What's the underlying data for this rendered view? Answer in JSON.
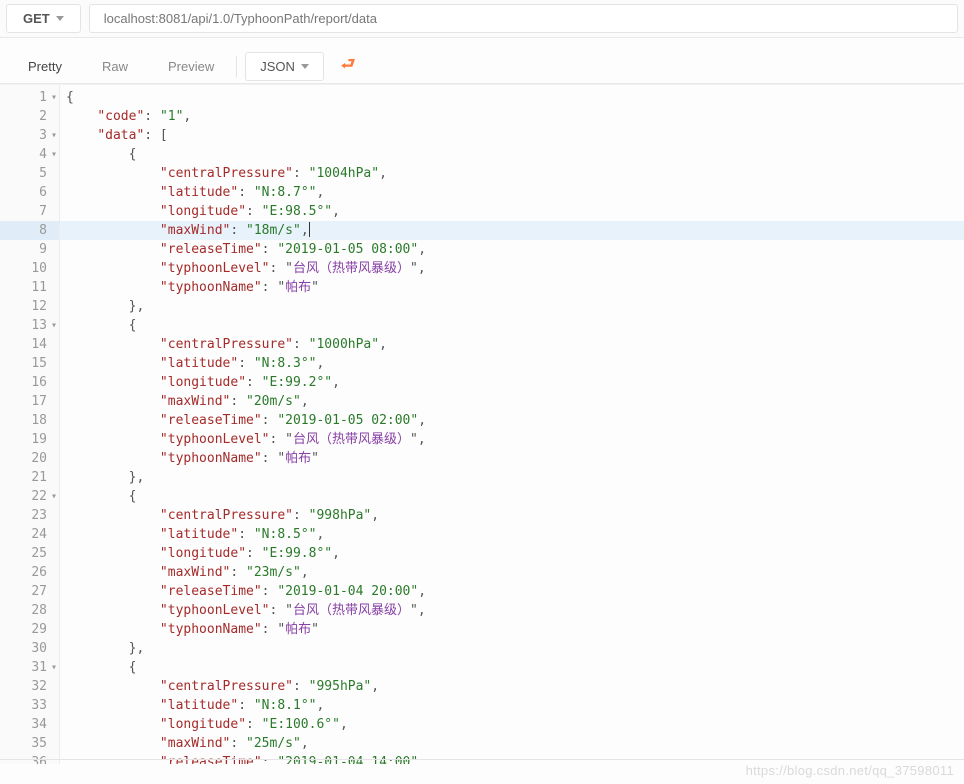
{
  "top": {
    "method": "GET",
    "url": "localhost:8081/api/1.0/TyphoonPath/report/data"
  },
  "tabs": {
    "pretty": "Pretty",
    "raw": "Raw",
    "preview": "Preview",
    "format": "JSON"
  },
  "highlighted_line": 8,
  "watermark": "https://blog.csdn.net/qq_37598011",
  "lines": [
    {
      "n": 1,
      "fold": true,
      "indent": 0,
      "type": "punc",
      "text": "{"
    },
    {
      "n": 2,
      "fold": false,
      "indent": 1,
      "type": "kv_str",
      "key": "code",
      "value": "1",
      "comma": true
    },
    {
      "n": 3,
      "fold": true,
      "indent": 1,
      "type": "key_open",
      "key": "data",
      "open": "["
    },
    {
      "n": 4,
      "fold": true,
      "indent": 2,
      "type": "punc",
      "text": "{"
    },
    {
      "n": 5,
      "fold": false,
      "indent": 3,
      "type": "kv_str",
      "key": "centralPressure",
      "value": "1004hPa",
      "comma": true
    },
    {
      "n": 6,
      "fold": false,
      "indent": 3,
      "type": "kv_str",
      "key": "latitude",
      "value": "N:8.7°",
      "comma": true
    },
    {
      "n": 7,
      "fold": false,
      "indent": 3,
      "type": "kv_str",
      "key": "longitude",
      "value": "E:98.5°",
      "comma": true
    },
    {
      "n": 8,
      "fold": false,
      "indent": 3,
      "type": "kv_str",
      "key": "maxWind",
      "value": "18m/s",
      "comma": true,
      "cursor": true
    },
    {
      "n": 9,
      "fold": false,
      "indent": 3,
      "type": "kv_str",
      "key": "releaseTime",
      "value": "2019-01-05 08:00",
      "comma": true
    },
    {
      "n": 10,
      "fold": false,
      "indent": 3,
      "type": "kv_cjk",
      "key": "typhoonLevel",
      "value": "台风（热带风暴级）",
      "comma": true
    },
    {
      "n": 11,
      "fold": false,
      "indent": 3,
      "type": "kv_cjk",
      "key": "typhoonName",
      "value": "帕布",
      "comma": false
    },
    {
      "n": 12,
      "fold": false,
      "indent": 2,
      "type": "punc",
      "text": "},"
    },
    {
      "n": 13,
      "fold": true,
      "indent": 2,
      "type": "punc",
      "text": "{"
    },
    {
      "n": 14,
      "fold": false,
      "indent": 3,
      "type": "kv_str",
      "key": "centralPressure",
      "value": "1000hPa",
      "comma": true
    },
    {
      "n": 15,
      "fold": false,
      "indent": 3,
      "type": "kv_str",
      "key": "latitude",
      "value": "N:8.3°",
      "comma": true
    },
    {
      "n": 16,
      "fold": false,
      "indent": 3,
      "type": "kv_str",
      "key": "longitude",
      "value": "E:99.2°",
      "comma": true
    },
    {
      "n": 17,
      "fold": false,
      "indent": 3,
      "type": "kv_str",
      "key": "maxWind",
      "value": "20m/s",
      "comma": true
    },
    {
      "n": 18,
      "fold": false,
      "indent": 3,
      "type": "kv_str",
      "key": "releaseTime",
      "value": "2019-01-05 02:00",
      "comma": true
    },
    {
      "n": 19,
      "fold": false,
      "indent": 3,
      "type": "kv_cjk",
      "key": "typhoonLevel",
      "value": "台风（热带风暴级）",
      "comma": true
    },
    {
      "n": 20,
      "fold": false,
      "indent": 3,
      "type": "kv_cjk",
      "key": "typhoonName",
      "value": "帕布",
      "comma": false
    },
    {
      "n": 21,
      "fold": false,
      "indent": 2,
      "type": "punc",
      "text": "},"
    },
    {
      "n": 22,
      "fold": true,
      "indent": 2,
      "type": "punc",
      "text": "{"
    },
    {
      "n": 23,
      "fold": false,
      "indent": 3,
      "type": "kv_str",
      "key": "centralPressure",
      "value": "998hPa",
      "comma": true
    },
    {
      "n": 24,
      "fold": false,
      "indent": 3,
      "type": "kv_str",
      "key": "latitude",
      "value": "N:8.5°",
      "comma": true
    },
    {
      "n": 25,
      "fold": false,
      "indent": 3,
      "type": "kv_str",
      "key": "longitude",
      "value": "E:99.8°",
      "comma": true
    },
    {
      "n": 26,
      "fold": false,
      "indent": 3,
      "type": "kv_str",
      "key": "maxWind",
      "value": "23m/s",
      "comma": true
    },
    {
      "n": 27,
      "fold": false,
      "indent": 3,
      "type": "kv_str",
      "key": "releaseTime",
      "value": "2019-01-04 20:00",
      "comma": true
    },
    {
      "n": 28,
      "fold": false,
      "indent": 3,
      "type": "kv_cjk",
      "key": "typhoonLevel",
      "value": "台风（热带风暴级）",
      "comma": true
    },
    {
      "n": 29,
      "fold": false,
      "indent": 3,
      "type": "kv_cjk",
      "key": "typhoonName",
      "value": "帕布",
      "comma": false
    },
    {
      "n": 30,
      "fold": false,
      "indent": 2,
      "type": "punc",
      "text": "},"
    },
    {
      "n": 31,
      "fold": true,
      "indent": 2,
      "type": "punc",
      "text": "{"
    },
    {
      "n": 32,
      "fold": false,
      "indent": 3,
      "type": "kv_str",
      "key": "centralPressure",
      "value": "995hPa",
      "comma": true
    },
    {
      "n": 33,
      "fold": false,
      "indent": 3,
      "type": "kv_str",
      "key": "latitude",
      "value": "N:8.1°",
      "comma": true
    },
    {
      "n": 34,
      "fold": false,
      "indent": 3,
      "type": "kv_str",
      "key": "longitude",
      "value": "E:100.6°",
      "comma": true
    },
    {
      "n": 35,
      "fold": false,
      "indent": 3,
      "type": "kv_str",
      "key": "maxWind",
      "value": "25m/s",
      "comma": true
    },
    {
      "n": 36,
      "fold": false,
      "indent": 3,
      "type": "kv_str",
      "key": "releaseTime",
      "value": "2019-01-04 14:00",
      "comma": true
    }
  ]
}
